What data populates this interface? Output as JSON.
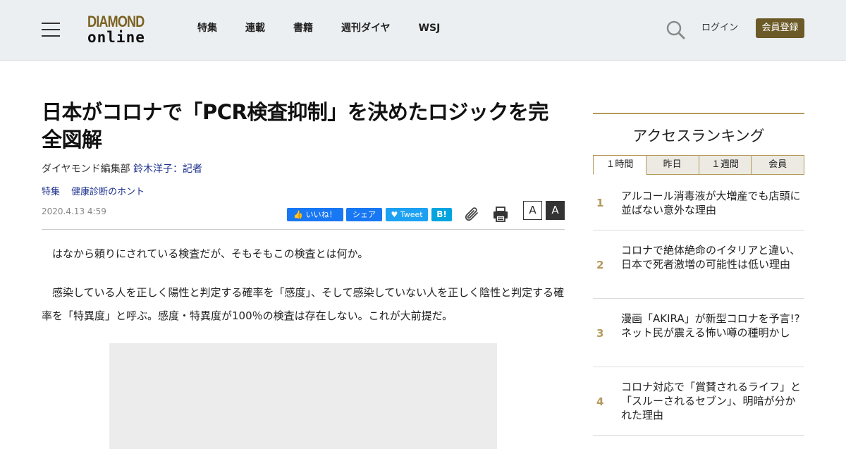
{
  "header": {
    "logo_top": "DIAMOND",
    "logo_bottom": "online",
    "nav": [
      "特集",
      "連載",
      "書籍",
      "週刊ダイヤ",
      "WSJ"
    ],
    "login": "ログイン",
    "register": "会員登録"
  },
  "article": {
    "title": "日本がコロナで「PCR検査抑制」を決めたロジックを完全図解",
    "byline_org": "ダイヤモンド編集部",
    "byline_author": "鈴木洋子：記者",
    "tags": [
      "特集",
      "健康診断のホント"
    ],
    "date": "2020.4.13 4:59",
    "share": {
      "like": "いいね！",
      "share": "シェア",
      "tweet": "Tweet",
      "hatena": "B!"
    },
    "font_small": "A",
    "font_large": "A",
    "paragraphs": [
      "はなから頼りにされている検査だが、そもそもこの検査とは何か。",
      "感染している人を正しく陽性と判定する確率を「感度」、そして感染していない人を正しく陰性と判定する確率を「特異度」と呼ぶ。感度・特異度が100％の検査は存在しない。これが大前提だ。"
    ]
  },
  "sidebar": {
    "title": "アクセスランキング",
    "tabs": [
      "１時間",
      "昨日",
      "１週間",
      "会員"
    ],
    "ranking": [
      {
        "num": "1",
        "text": "アルコール消毒液が大増産でも店頭に並ばない意外な理由"
      },
      {
        "num": "2",
        "text": "コロナで絶体絶命のイタリアと違い、日本で死者激増の可能性は低い理由"
      },
      {
        "num": "3",
        "text": "漫画「AKIRA」が新型コロナを予言!?ネット民が震える怖い噂の種明かし"
      },
      {
        "num": "4",
        "text": "コロナ対応で「賞賛されるライフ」と「スルーされるセブン」、明暗が分かれた理由"
      }
    ]
  }
}
